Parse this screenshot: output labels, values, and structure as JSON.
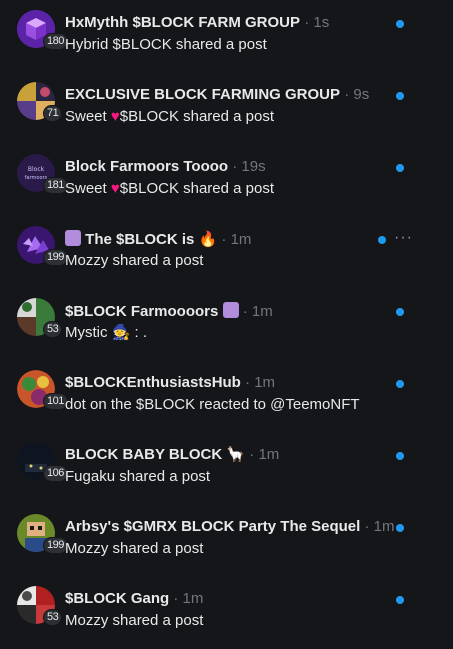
{
  "chats": [
    {
      "name": "HxMythh $BLOCK FARM GROUP",
      "time": "1s",
      "preview": "Hybrid $BLOCK shared a post",
      "badge": "180",
      "avatar": "block-cube-avatar",
      "unread": true
    },
    {
      "name": "EXCLUSIVE BLOCK FARMING GROUP",
      "time": "9s",
      "preview_heart": true,
      "preview_pre": "Sweet ",
      "preview_post": "$BLOCK shared a post",
      "badge": "71",
      "avatar": "group-collage-avatar",
      "unread": true
    },
    {
      "name": "Block Farmoors Toooo",
      "time": "19s",
      "preview_heart": true,
      "preview_pre": "Sweet ",
      "preview_post": "$BLOCK shared a post",
      "badge": "181",
      "avatar": "block-logo-avatar",
      "unread": true
    },
    {
      "name": "The $BLOCK is",
      "time": "1m",
      "preview": "Mozzy shared a post",
      "badge": "199",
      "avatar": "purple-crystal-avatar",
      "unread": true,
      "has_more": true
    },
    {
      "name": "$BLOCK Farmoooors",
      "time": "1m",
      "preview": "Mystic 🧙 : .",
      "badge": "53",
      "avatar": "group-collage-avatar-2",
      "unread": true
    },
    {
      "name": "$BLOCKEnthusiastsHub",
      "time": "1m",
      "preview": "dot on the $BLOCK reacted to @TeemoNFT",
      "badge": "101",
      "avatar": "colorful-art-avatar",
      "unread": true
    },
    {
      "name": "BLOCK BABY BLOCK",
      "time": "1m",
      "preview": "Fugaku shared a post",
      "badge": "106",
      "avatar": "dark-scene-avatar",
      "unread": true
    },
    {
      "name": "Arbsy's $GMRX BLOCK Party The Sequel",
      "time": "1m",
      "preview": "Mozzy shared a post",
      "badge": "199",
      "avatar": "pixel-art-avatar",
      "unread": true
    },
    {
      "name": "$BLOCK Gang",
      "time": "1m",
      "preview": "Mozzy shared a post",
      "badge": "53",
      "avatar": "red-collage-avatar",
      "unread": true
    }
  ],
  "colors": {
    "accent": "#1d9bf0",
    "background": "#15161a",
    "heart": "#f91880"
  }
}
